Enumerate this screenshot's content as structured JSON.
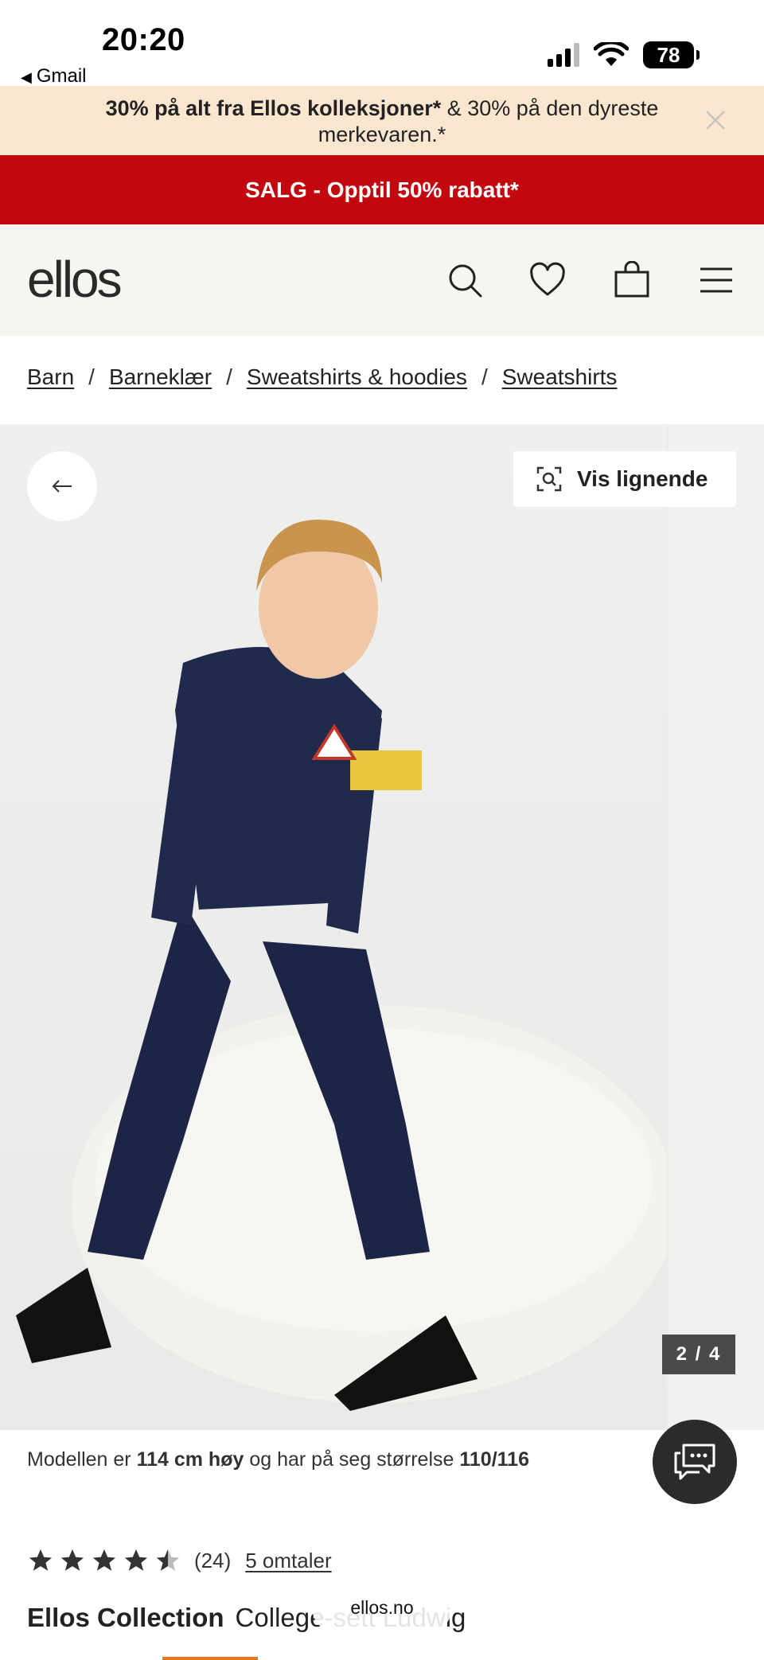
{
  "status_bar": {
    "time": "20:20",
    "back_app": "Gmail",
    "battery": "78"
  },
  "promo": {
    "bold_text": "30% på alt fra Ellos kolleksjoner*",
    "rest_text": " & 30% på den dyreste merkevaren.*",
    "close_icon": "close-icon"
  },
  "sale": {
    "text": "SALG - Opptil 50% rabatt*"
  },
  "header": {
    "logo": "ellos",
    "icons": [
      "search-icon",
      "heart-icon",
      "bag-icon",
      "menu-icon"
    ]
  },
  "breadcrumb": [
    "Barn",
    "Barneklær",
    "Sweatshirts & hoodies",
    "Sweatshirts"
  ],
  "gallery": {
    "similar_label": "Vis lignende",
    "counter": "2 / 4"
  },
  "model_info": {
    "prefix": "Modellen er ",
    "height": "114 cm høy",
    "middle": " og har på seg størrelse ",
    "size": "110/116"
  },
  "rating": {
    "stars": 4.5,
    "count": "(24)",
    "reviews": "5 omtaler"
  },
  "product": {
    "brand": "Ellos Collection",
    "name": "College-sett Ludwig"
  },
  "browser": {
    "url": "ellos.no"
  },
  "colors": {
    "promo_bg": "#fbe7d0",
    "sale_bg": "#c2070f",
    "header_bg": "#f7f5f1",
    "accent": "#e07b23"
  }
}
